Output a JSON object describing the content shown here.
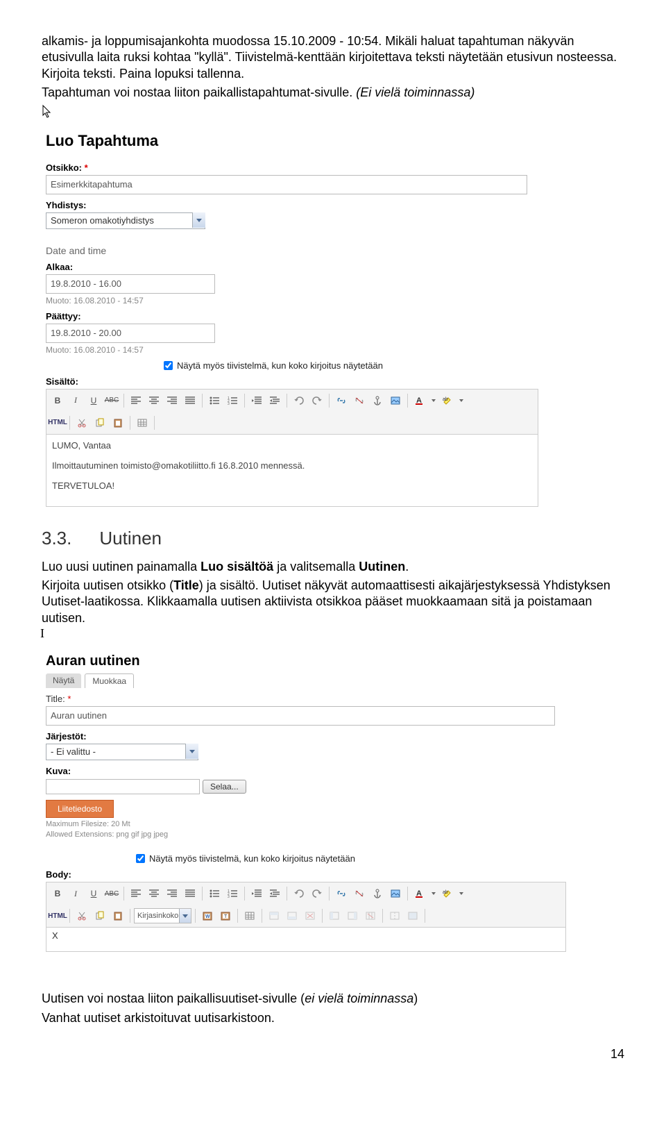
{
  "intro": {
    "p1a": "alkamis- ja loppumisajankohta muodossa 15.10.2009 - 10:54. Mikäli haluat tapahtuman näkyvän etusivulla laita ruksi kohtaa \"kyllä\". Tiivistelmä-kenttään kirjoitettava teksti näytetään etusivun nosteessa. Kirjoita teksti. Paina lopuksi tallenna.",
    "p2": "Tapahtuman voi nostaa liiton paikallistapahtumat-sivulle. ",
    "p2i": "(Ei vielä toiminnassa)"
  },
  "form1": {
    "title": "Luo Tapahtuma",
    "otsikko_label": "Otsikko:",
    "otsikko_val": "Esimerkkitapahtuma",
    "yhdistys_label": "Yhdistys:",
    "yhdistys_val": "Someron omakotiyhdistys",
    "datetime": "Date and time",
    "alkaa_label": "Alkaa:",
    "alkaa_val": "19.8.2010 - 16.00",
    "paattyy_label": "Päättyy:",
    "paattyy_val": "19.8.2010 - 20.00",
    "muoto": "Muoto: 16.08.2010 - 14:57",
    "cb_label": "Näytä myös tiivistelmä, kun koko kirjoitus näytetään",
    "sisalto": "Sisältö:",
    "content_l1": "LUMO, Vantaa",
    "content_l2": "Ilmoittautuminen toimisto@omakotiliitto.fi 16.8.2010 mennessä.",
    "content_l3": "TERVETULOA!"
  },
  "section": {
    "num": "3.3.",
    "title": "Uutinen"
  },
  "sec_text": {
    "p1a": "Luo uusi uutinen painamalla ",
    "p1b": "Luo sisältöä",
    "p1c": " ja valitsemalla ",
    "p1d": "Uutinen",
    "p1e": ".",
    "p2a": "Kirjoita uutisen otsikko (",
    "p2b": "Title",
    "p2c": ") ja sisältö. Uutiset näkyvät automaattisesti aikajärjestyksessä Yhdistyksen Uutiset-laatikossa. Klikkaamalla uutisen aktiivista otsikkoa pääset muokkaamaan sitä ja poistamaan uutisen."
  },
  "form2": {
    "title": "Auran uutinen",
    "tab_nayta": "Näytä",
    "tab_muokkaa": "Muokkaa",
    "title_label": "Title:",
    "title_val": "Auran uutinen",
    "jarjestot_label": "Järjestöt:",
    "jarjestot_val": "- Ei valittu -",
    "kuva_label": "Kuva:",
    "selaa": "Selaa...",
    "liite": "Liitetiedosto",
    "max": "Maximum Filesize: 20 Mt",
    "ext": "Allowed Extensions: png gif jpg jpeg",
    "body_label": "Body:",
    "cb_label": "Näytä myös tiivistelmä, kun koko kirjoitus näytetään",
    "fontsize": "Kirjasinkoko",
    "x": "X"
  },
  "footer": {
    "p1a": "Uutisen voi nostaa liiton paikallisuutiset-sivulle (",
    "p1b": "ei vielä toiminnassa",
    "p1c": ")",
    "p2": "Vanhat uutiset arkistoituvat uutisarkistoon.",
    "page": "14"
  }
}
